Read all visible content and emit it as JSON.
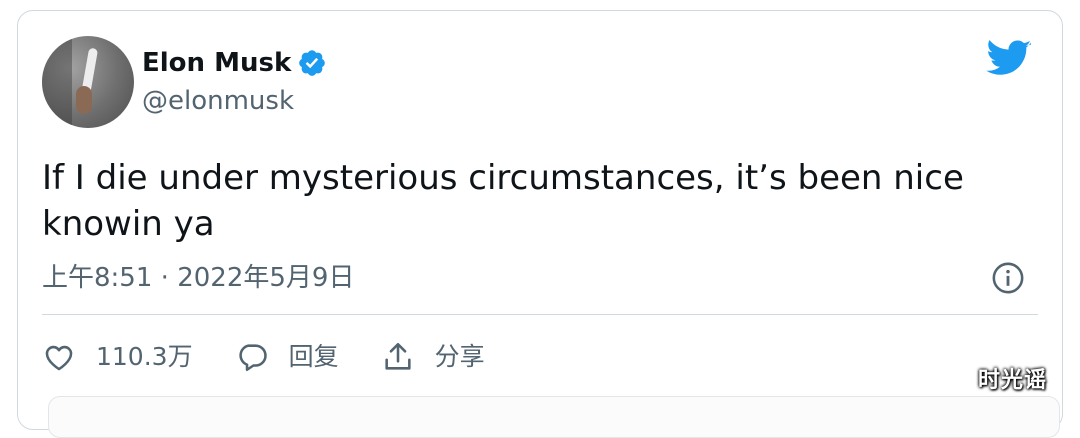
{
  "author": {
    "name": "Elon Musk",
    "handle": "@elonmusk"
  },
  "tweet": {
    "text": "If I die under mysterious circumstances, it’s been nice knowin ya",
    "time": "上午8:51",
    "separator": " · ",
    "date": "2022年5月9日"
  },
  "actions": {
    "like_count": "110.3万",
    "reply_label": "回复",
    "share_label": "分享"
  },
  "watermark": "时光谣",
  "colors": {
    "brand": "#1d9bf0",
    "secondary_text": "#536471",
    "divider": "#cfd9de"
  },
  "icons": [
    "twitter-bird-icon",
    "verified-badge-icon",
    "info-icon",
    "heart-icon",
    "reply-icon",
    "share-icon"
  ]
}
